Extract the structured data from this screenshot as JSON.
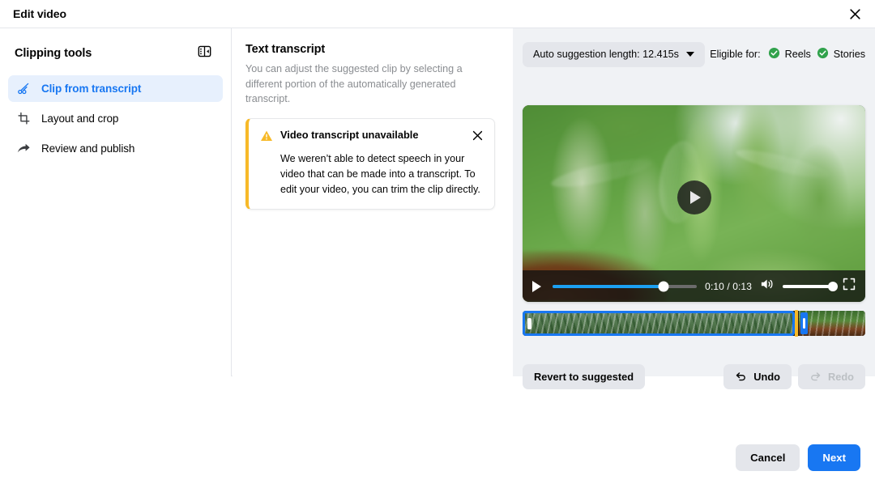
{
  "window": {
    "title": "Edit video",
    "close_icon": "close-icon"
  },
  "sidebar": {
    "title": "Clipping tools",
    "panel_toggle_icon": "panel-collapse-icon",
    "items": [
      {
        "label": "Clip from transcript",
        "icon": "scissors-icon",
        "active": true
      },
      {
        "label": "Layout and crop",
        "icon": "crop-icon",
        "active": false
      },
      {
        "label": "Review and publish",
        "icon": "share-arrow-icon",
        "active": false
      }
    ]
  },
  "transcript": {
    "title": "Text transcript",
    "description": "You can adjust the suggested clip by selecting a different portion of the automatically generated transcript.",
    "alert": {
      "warning_icon": "warning-triangle-icon",
      "title": "Video transcript unavailable",
      "body": "We weren’t able to detect speech in your video that can be made into a transcript. To edit your video, you can trim the clip directly.",
      "close_icon": "close-icon",
      "accent_color": "#f7b928"
    }
  },
  "preview": {
    "suggestion_chip": {
      "label": "Auto suggestion length: 12.415s",
      "caret_icon": "chevron-down-icon"
    },
    "eligible": {
      "label": "Eligible for:",
      "targets": [
        {
          "name": "Reels",
          "icon": "check-circle-icon",
          "color": "#31a24c"
        },
        {
          "name": "Stories",
          "icon": "check-circle-icon",
          "color": "#31a24c"
        }
      ]
    },
    "player": {
      "center_play_icon": "play-circle-icon",
      "play_icon": "play-icon",
      "current_time": "0:10",
      "separator": "/",
      "total_time": "0:13",
      "time_display": "0:10 / 0:13",
      "progress_percent": 77,
      "volume_icon": "volume-icon",
      "volume_percent": 100,
      "fullscreen_icon": "fullscreen-icon",
      "accent_color": "#1ca0f2"
    },
    "timeline": {
      "selection_color": "#1877f2",
      "playhead_color": "#f7b928",
      "left_handle_icon": "trim-handle-icon",
      "right_handle_icon": "trim-handle-icon"
    },
    "actions": {
      "revert": "Revert to suggested",
      "undo": "Undo",
      "undo_icon": "undo-arrow-icon",
      "redo": "Redo",
      "redo_icon": "redo-arrow-icon",
      "redo_disabled": true
    }
  },
  "footer": {
    "cancel": "Cancel",
    "next": "Next",
    "primary_color": "#1877f2"
  }
}
